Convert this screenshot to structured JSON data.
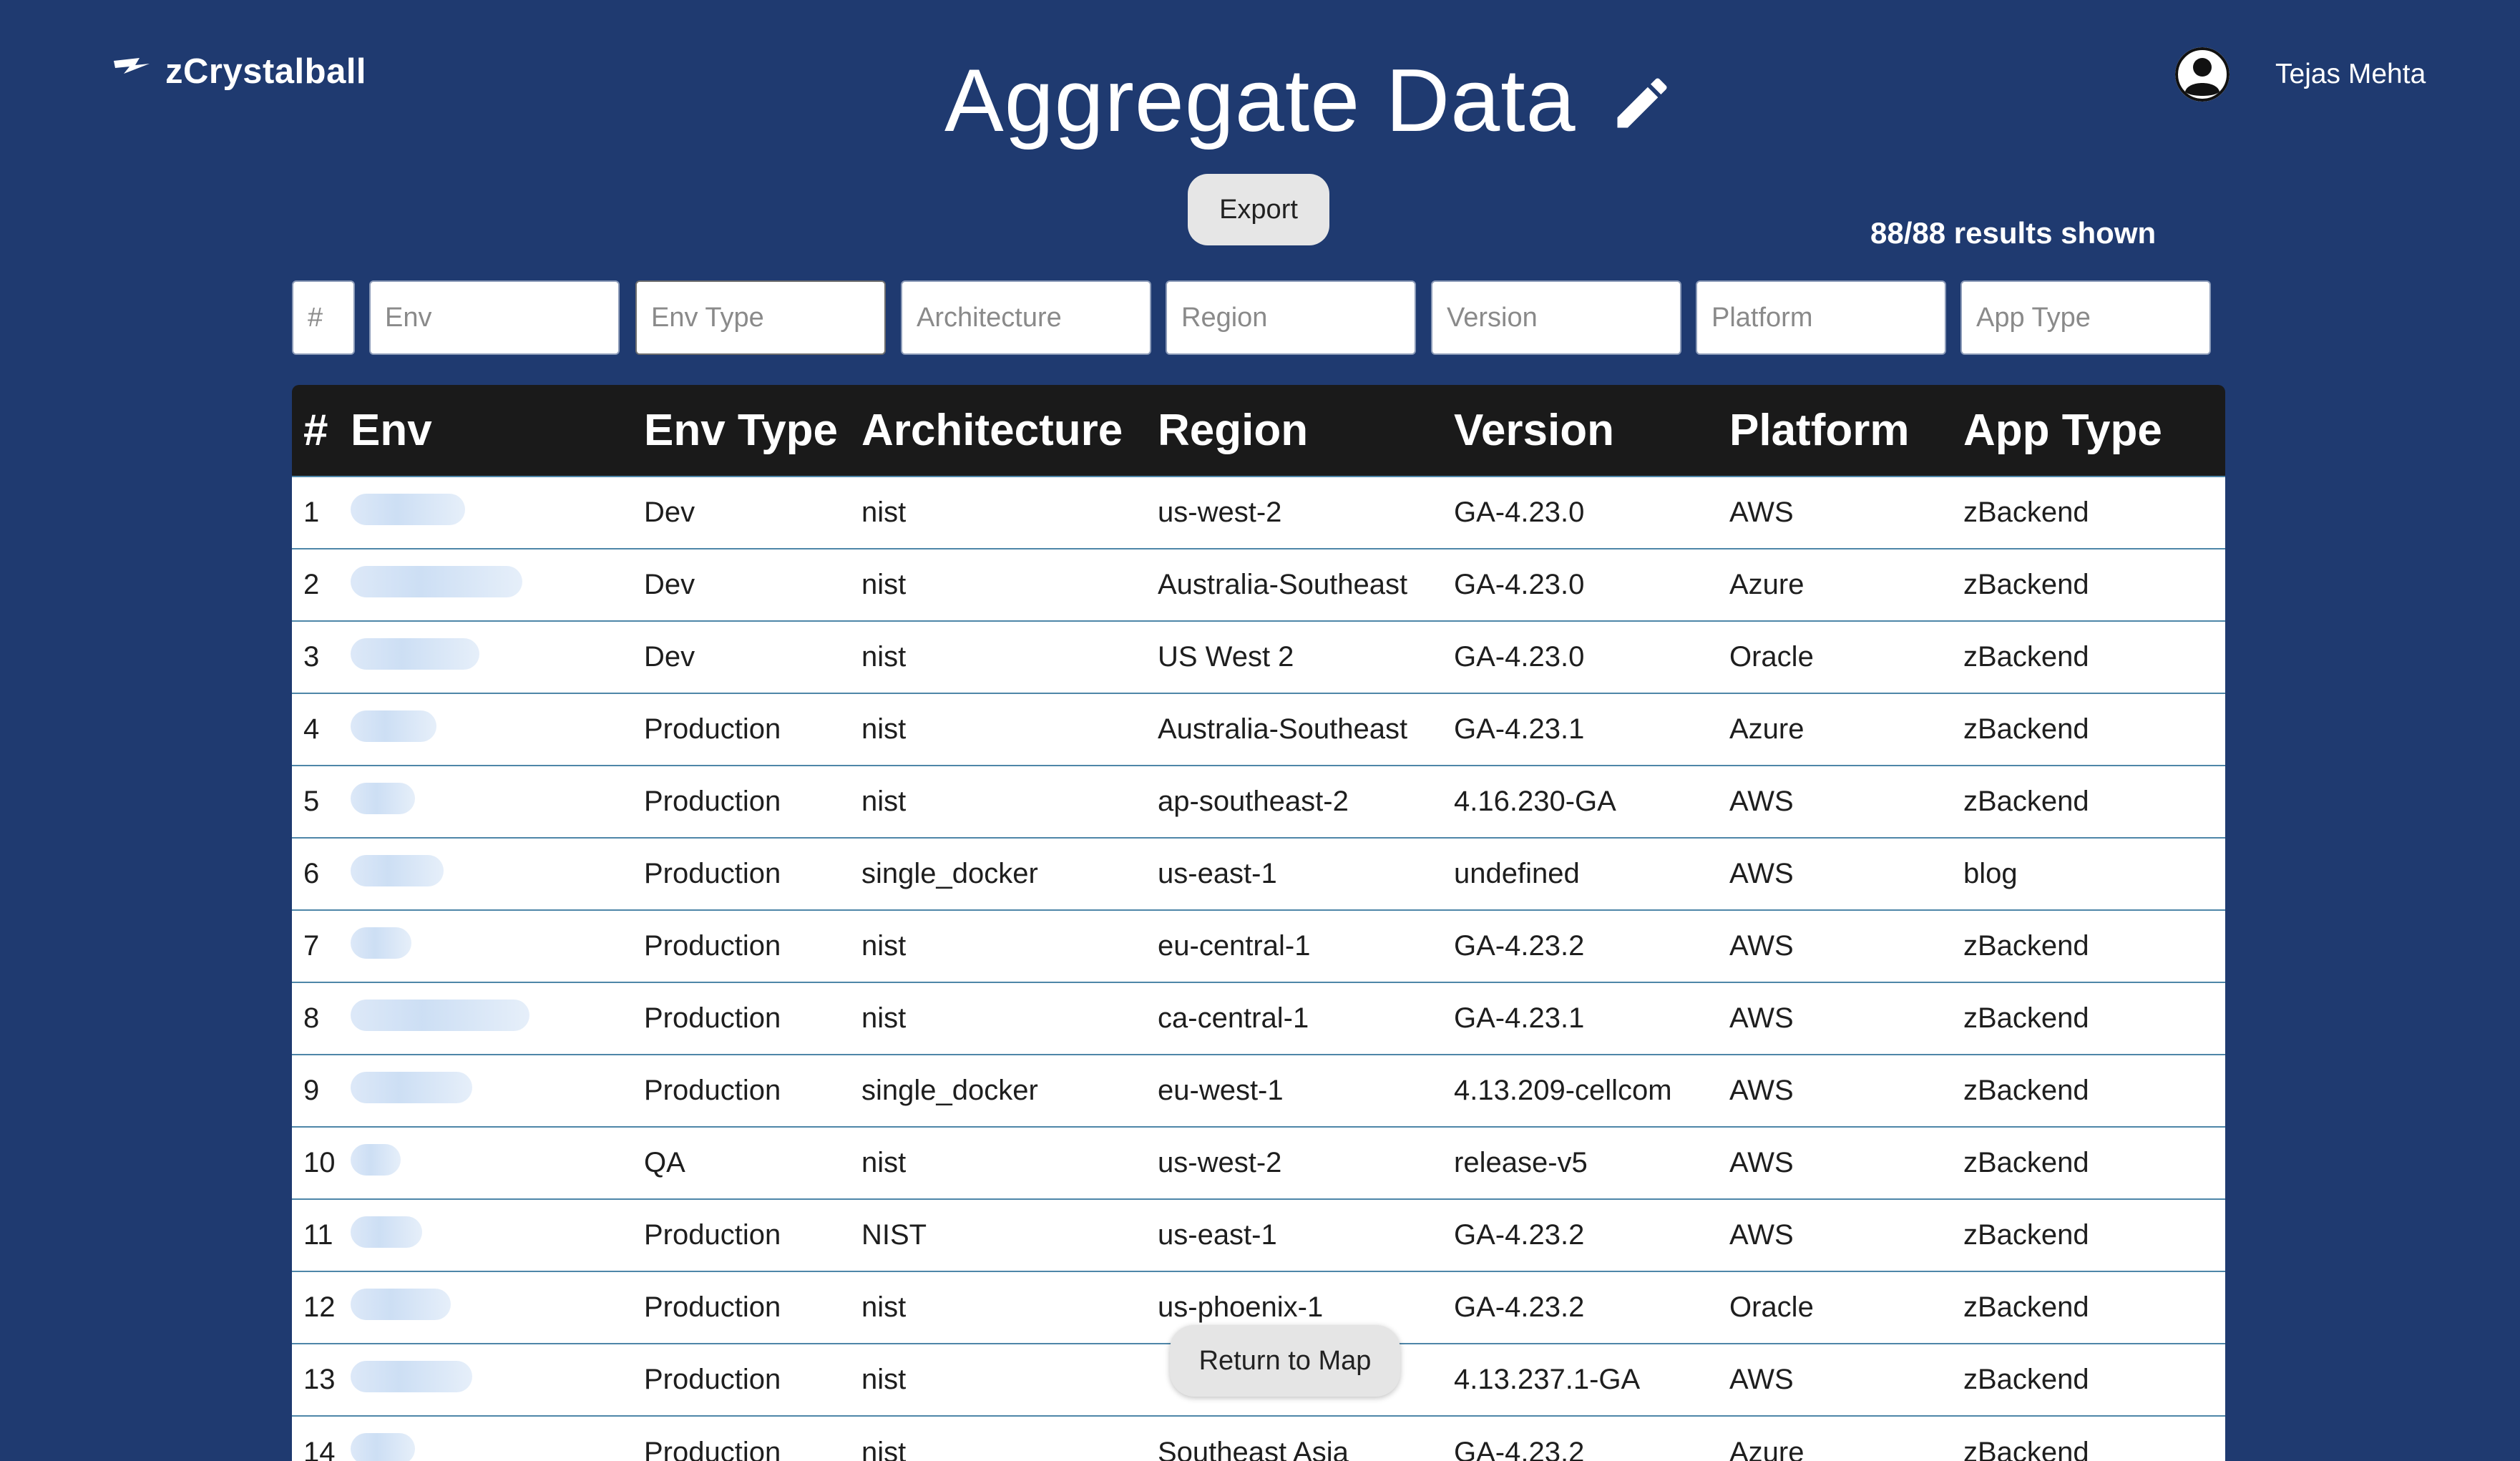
{
  "brand": {
    "name": "zCrystalball"
  },
  "header": {
    "title": "Aggregate Data",
    "user_name": "Tejas Mehta"
  },
  "toolbar": {
    "export_label": "Export",
    "results_text": "88/88 results shown"
  },
  "filters": [
    {
      "placeholder": "#"
    },
    {
      "placeholder": "Env"
    },
    {
      "placeholder": "Env Type"
    },
    {
      "placeholder": "Architecture"
    },
    {
      "placeholder": "Region"
    },
    {
      "placeholder": "Version"
    },
    {
      "placeholder": "Platform"
    },
    {
      "placeholder": "App Type"
    }
  ],
  "table": {
    "columns": [
      "#",
      "Env",
      "Env Type",
      "Architecture",
      "Region",
      "Version",
      "Platform",
      "App Type"
    ],
    "rows": [
      {
        "num": "1",
        "env": "",
        "env_type": "Dev",
        "arch": "nist",
        "region": "us-west-2",
        "version": "GA-4.23.0",
        "platform": "AWS",
        "app_type": "zBackend"
      },
      {
        "num": "2",
        "env": "",
        "env_type": "Dev",
        "arch": "nist",
        "region": "Australia-Southeast",
        "version": "GA-4.23.0",
        "platform": "Azure",
        "app_type": "zBackend"
      },
      {
        "num": "3",
        "env": "",
        "env_type": "Dev",
        "arch": "nist",
        "region": "US West 2",
        "version": "GA-4.23.0",
        "platform": "Oracle",
        "app_type": "zBackend"
      },
      {
        "num": "4",
        "env": "",
        "env_type": "Production",
        "arch": "nist",
        "region": "Australia-Southeast",
        "version": "GA-4.23.1",
        "platform": "Azure",
        "app_type": "zBackend"
      },
      {
        "num": "5",
        "env": "",
        "env_type": "Production",
        "arch": "nist",
        "region": "ap-southeast-2",
        "version": "4.16.230-GA",
        "platform": "AWS",
        "app_type": "zBackend"
      },
      {
        "num": "6",
        "env": "",
        "env_type": "Production",
        "arch": "single_docker",
        "region": "us-east-1",
        "version": "undefined",
        "platform": "AWS",
        "app_type": "blog"
      },
      {
        "num": "7",
        "env": "",
        "env_type": "Production",
        "arch": "nist",
        "region": "eu-central-1",
        "version": "GA-4.23.2",
        "platform": "AWS",
        "app_type": "zBackend"
      },
      {
        "num": "8",
        "env": "",
        "env_type": "Production",
        "arch": "nist",
        "region": "ca-central-1",
        "version": "GA-4.23.1",
        "platform": "AWS",
        "app_type": "zBackend"
      },
      {
        "num": "9",
        "env": "",
        "env_type": "Production",
        "arch": "single_docker",
        "region": "eu-west-1",
        "version": "4.13.209-cellcom",
        "platform": "AWS",
        "app_type": "zBackend"
      },
      {
        "num": "10",
        "env": "",
        "env_type": "QA",
        "arch": "nist",
        "region": "us-west-2",
        "version": "release-v5",
        "platform": "AWS",
        "app_type": "zBackend"
      },
      {
        "num": "11",
        "env": "",
        "env_type": "Production",
        "arch": "NIST",
        "region": "us-east-1",
        "version": "GA-4.23.2",
        "platform": "AWS",
        "app_type": "zBackend"
      },
      {
        "num": "12",
        "env": "",
        "env_type": "Production",
        "arch": "nist",
        "region": "us-phoenix-1",
        "version": "GA-4.23.2",
        "platform": "Oracle",
        "app_type": "zBackend"
      },
      {
        "num": "13",
        "env": "",
        "env_type": "Production",
        "arch": "nist",
        "region": "",
        "version": "4.13.237.1-GA",
        "platform": "AWS",
        "app_type": "zBackend"
      },
      {
        "num": "14",
        "env": "",
        "env_type": "Production",
        "arch": "nist",
        "region": "Southeast Asia",
        "version": "GA-4.23.2",
        "platform": "Azure",
        "app_type": "zBackend"
      }
    ]
  },
  "footer": {
    "return_label": "Return to Map"
  }
}
